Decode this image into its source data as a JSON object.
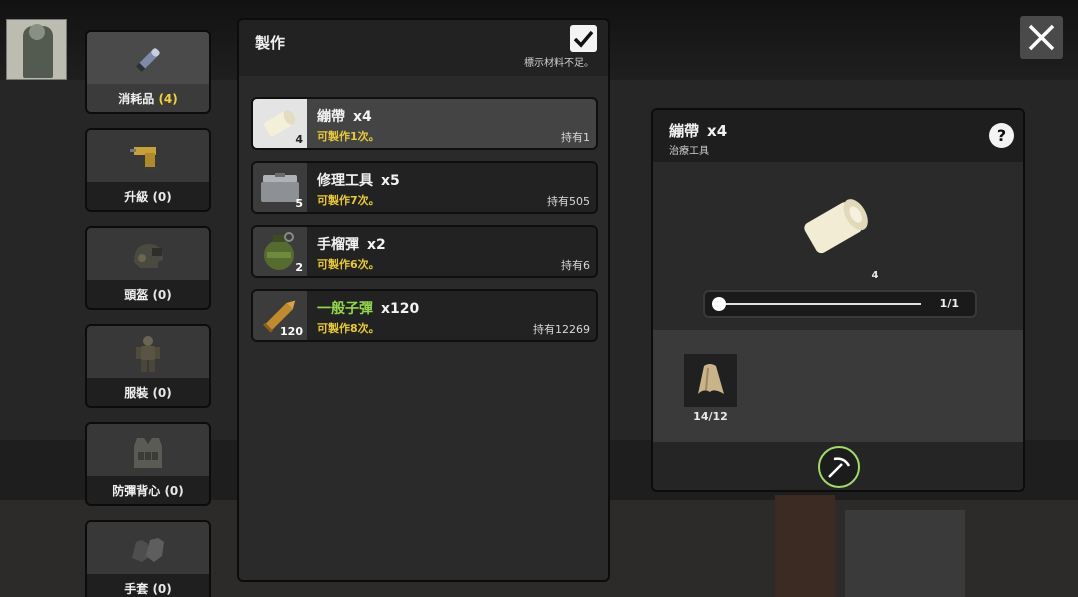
{
  "categories": [
    {
      "label": "消耗品",
      "count": "(4)"
    },
    {
      "label": "升級",
      "count": "(0)"
    },
    {
      "label": "頭盔",
      "count": "(0)"
    },
    {
      "label": "服裝",
      "count": "(0)"
    },
    {
      "label": "防彈背心",
      "count": "(0)"
    },
    {
      "label": "手套",
      "count": "(0)"
    }
  ],
  "craft_panel": {
    "title": "製作",
    "show_insufficient_label": "標示材料不足。",
    "recipes": [
      {
        "name": "繃帶",
        "mult": "x4",
        "thumb_qty": "4",
        "can_craft": "可製作1次。",
        "owned": "持有1",
        "selected": true
      },
      {
        "name": "修理工具",
        "mult": "x5",
        "thumb_qty": "5",
        "can_craft": "可製作7次。",
        "owned": "持有505"
      },
      {
        "name": "手榴彈",
        "mult": "x2",
        "thumb_qty": "2",
        "can_craft": "可製作6次。",
        "owned": "持有6"
      },
      {
        "name": "一般子彈",
        "mult": "x120",
        "thumb_qty": "120",
        "can_craft": "可製作8次。",
        "owned": "持有12269"
      }
    ]
  },
  "detail": {
    "name": "繃帶",
    "mult": "x4",
    "type": "治療工具",
    "help": "?",
    "preview_qty": "4",
    "slider_value": "1/1",
    "material_count": "14/12"
  },
  "colors": {
    "accent_yellow": "#e9c93a",
    "name_green": "#94d64e",
    "craft_button_ring": "#a3d96a"
  },
  "icons": {
    "close": "close-icon",
    "check": "checkmark-icon",
    "craft": "pickaxe-icon"
  }
}
